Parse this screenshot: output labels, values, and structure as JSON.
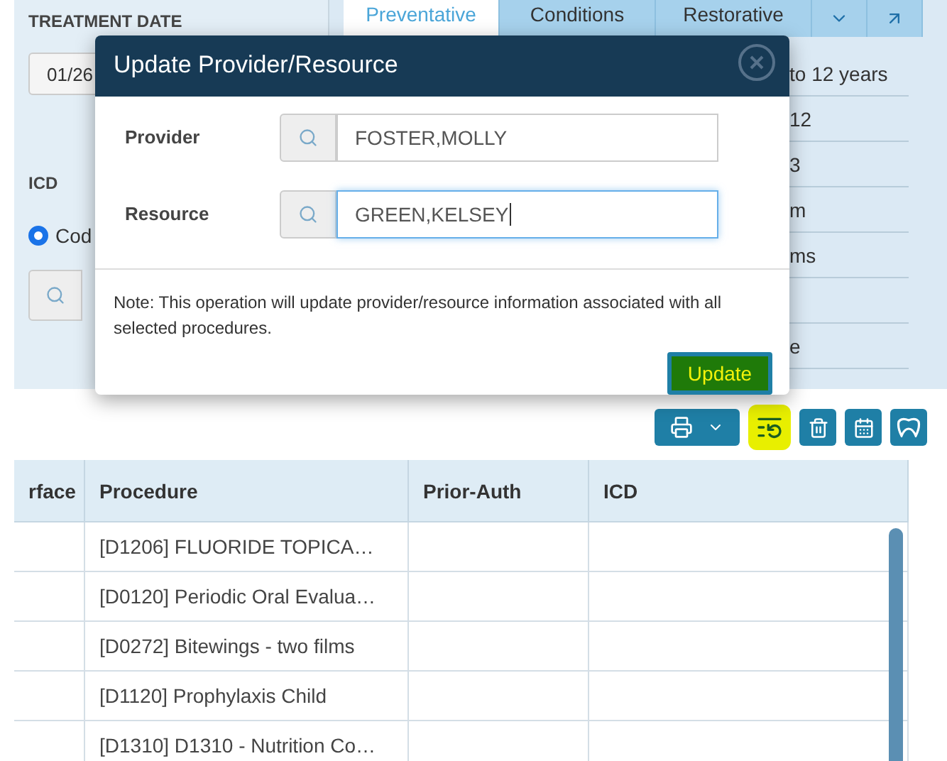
{
  "left_panel": {
    "treatment_date_label": "TREATMENT DATE",
    "date_value": "01/26",
    "icd_label": "ICD",
    "code_radio": {
      "label": "Cod",
      "selected": true
    }
  },
  "tabs": [
    {
      "label": "Preventative",
      "selected": true
    },
    {
      "label": "Conditions",
      "selected": false
    },
    {
      "label": "Restorative",
      "selected": false
    }
  ],
  "right_list": [
    "to 12 years",
    "12",
    "3",
    "m",
    "ms"
  ],
  "right_list_lower": [
    "e"
  ],
  "dialog": {
    "title": "Update Provider/Resource",
    "fields": [
      {
        "label": "Provider",
        "value": "FOSTER,MOLLY",
        "focused": false
      },
      {
        "label": "Resource",
        "value": "GREEN,KELSEY",
        "focused": true
      }
    ],
    "note": "Note: This operation will update provider/resource information associated with all selected procedures.",
    "button": "Update"
  },
  "table": {
    "columns": [
      "rface",
      "Procedure",
      "Prior-Auth",
      "ICD"
    ],
    "rows": [
      [
        "",
        "[D1206] FLUORIDE TOPICA…",
        "",
        ""
      ],
      [
        "",
        "[D0120] Periodic Oral Evalua…",
        "",
        ""
      ],
      [
        "",
        "[D0272] Bitewings - two films",
        "",
        ""
      ],
      [
        "",
        "[D1120] Prophylaxis Child",
        "",
        ""
      ],
      [
        "",
        "[D1310] D1310 - Nutrition Co…",
        "",
        ""
      ]
    ]
  }
}
